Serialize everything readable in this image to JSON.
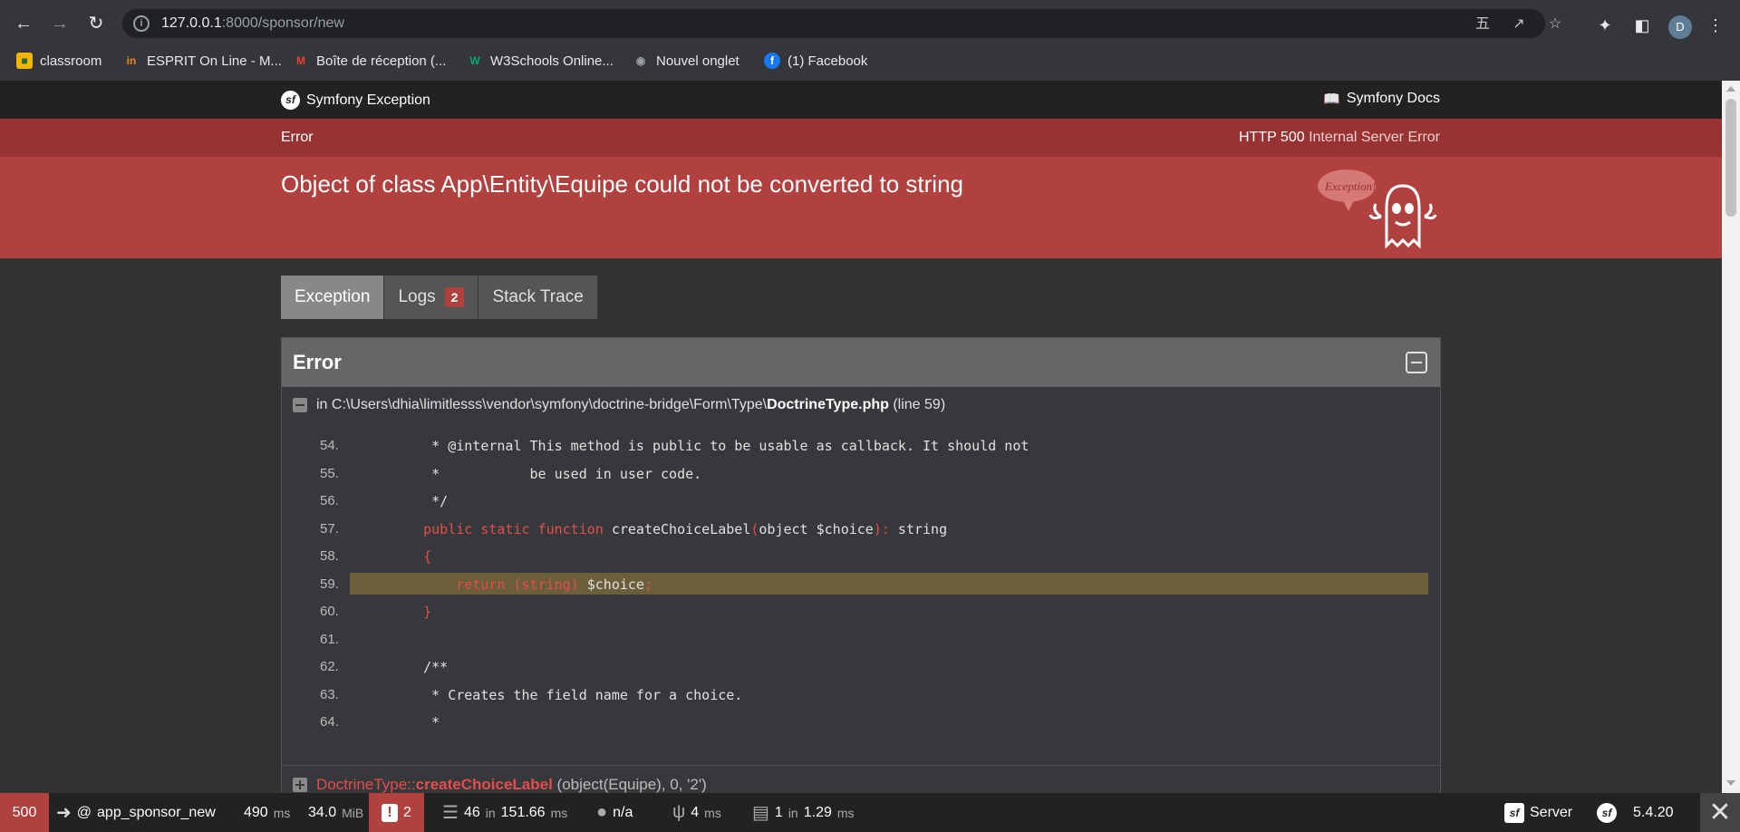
{
  "browser": {
    "url_host": "127.0.0.1",
    "url_rest": ":8000/sponsor/new",
    "avatar_letter": "D",
    "bookmarks": [
      {
        "label": "classroom",
        "icon": "classroom-icon"
      },
      {
        "label": "ESPRIT On Line - M...",
        "icon": "esprit-icon"
      },
      {
        "label": "Boîte de réception (...",
        "icon": "gmail-icon"
      },
      {
        "label": "W3Schools Online...",
        "icon": "w3schools-icon"
      },
      {
        "label": "Nouvel onglet",
        "icon": "globe-icon"
      },
      {
        "label": "(1) Facebook",
        "icon": "facebook-icon"
      }
    ]
  },
  "header": {
    "brand": "Symfony Exception",
    "docs": "Symfony Docs"
  },
  "error_strip": {
    "left": "Error",
    "status_code": "HTTP 500",
    "status_text": "Internal Server Error"
  },
  "exception": {
    "message": "Object of class App\\Entity\\Equipe could not be converted to string",
    "ghost_text": "Exception!"
  },
  "tabs": [
    {
      "label": "Exception"
    },
    {
      "label": "Logs",
      "badge": "2"
    },
    {
      "label": "Stack Trace"
    }
  ],
  "panel": {
    "title": "Error",
    "trace_prefix": "in C:\\Users\\dhia\\limitlesss\\vendor\\symfony\\doctrine-bridge\\Form\\Type\\",
    "trace_file": "DoctrineType.php",
    "trace_line": "(line 59)",
    "code": [
      {
        "ln": "54.",
        "text": "     * @internal This method is public to be usable as callback. It should not"
      },
      {
        "ln": "55.",
        "text": "     *           be used in user code."
      },
      {
        "ln": "56.",
        "text": "     */"
      },
      {
        "ln": "57.",
        "text": "    public static function createChoiceLabel(object $choice): string"
      },
      {
        "ln": "58.",
        "text": "    {"
      },
      {
        "ln": "59.",
        "text": "        return (string) $choice;"
      },
      {
        "ln": "60.",
        "text": "    }"
      },
      {
        "ln": "61.",
        "text": ""
      },
      {
        "ln": "62.",
        "text": "    /**"
      },
      {
        "ln": "63.",
        "text": "     * Creates the field name for a choice."
      },
      {
        "ln": "64.",
        "text": "     *"
      }
    ],
    "trace2_class": "DoctrineType",
    "trace2_sep": "::",
    "trace2_fn": "createChoiceLabel",
    "trace2_args": "(object(Equipe), 0, '2')"
  },
  "toolbar": {
    "status": "500",
    "route_prefix": "@",
    "route": "app_sponsor_new",
    "time": "490",
    "time_unit": "ms",
    "memory": "34.0",
    "memory_unit": "MiB",
    "logs": "2",
    "queries": "46",
    "queries_in": "in",
    "queries_time": "151.66",
    "queries_unit": "ms",
    "user": "n/a",
    "twig_time": "4",
    "twig_unit": "ms",
    "cache_count": "1",
    "cache_in": "in",
    "cache_time": "1.29",
    "cache_unit": "ms",
    "server": "Server",
    "version": "5.4.20"
  },
  "colors": {
    "error_red": "#b0413e",
    "error_strip": "#993333",
    "highlight": "#6b5e3a",
    "keyword": "#e44d4d"
  }
}
